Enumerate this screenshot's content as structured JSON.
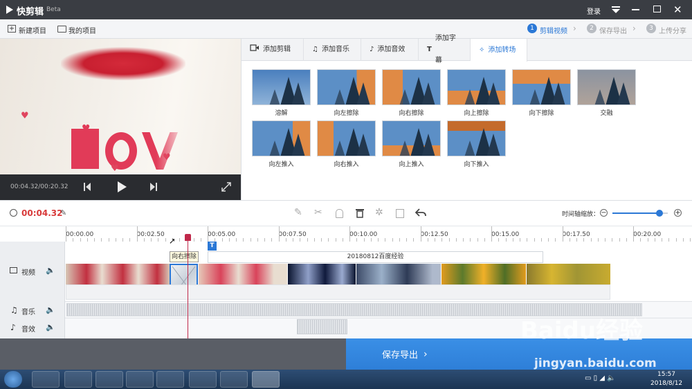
{
  "app": {
    "name": "快剪辑",
    "badge": "Beta"
  },
  "titlebar": {
    "login": "登录"
  },
  "toolbar": {
    "new_project": "新建项目",
    "my_projects": "我的项目"
  },
  "steps": [
    {
      "num": "1",
      "label": "剪辑视频"
    },
    {
      "num": "2",
      "label": "保存导出"
    },
    {
      "num": "3",
      "label": "上传分享"
    }
  ],
  "player": {
    "time": "00:04.32/00:20.32"
  },
  "tabs": [
    "添加剪辑",
    "添加音乐",
    "添加音效",
    "添加字幕",
    "添加转场"
  ],
  "transitions_row1": [
    "溶解",
    "向左擦除",
    "向右擦除",
    "向上擦除",
    "向下擦除",
    "交融"
  ],
  "transitions_row2": [
    "向左推入",
    "向右推入",
    "向上推入",
    "向下推入"
  ],
  "editbar": {
    "current_time": "00:04.32",
    "zoom_label": "时间轴缩放：",
    "zoom_level": 0.85
  },
  "ruler": [
    "00:00.00",
    "00:02.50",
    "00:05.00",
    "00:07.50",
    "00:10.00",
    "00:12.50",
    "00:15.00",
    "00:17.50",
    "00:20.00"
  ],
  "tracks": {
    "video": "视频",
    "music": "音乐",
    "effect": "音效"
  },
  "subtitle_clip": "20180812百度经验",
  "tooltip": "向右擦除",
  "save_export": "保存导出",
  "watermark": {
    "brand": "Baidu经验",
    "url": "jingyan.baidu.com"
  },
  "clock": {
    "time": "15:57",
    "date": "2018/8/12"
  }
}
